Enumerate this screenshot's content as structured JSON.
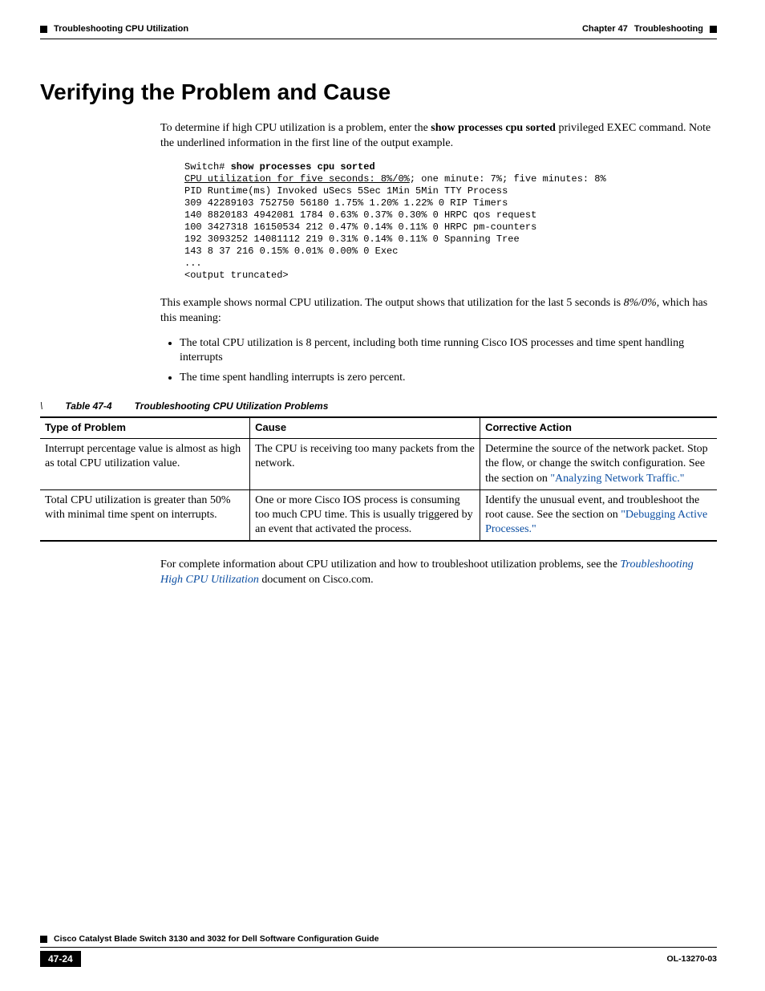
{
  "header": {
    "chapter_label": "Chapter 47",
    "chapter_title": "Troubleshooting",
    "section_breadcrumb": "Troubleshooting CPU Utilization"
  },
  "section": {
    "title": "Verifying the Problem and Cause",
    "intro_part1": "To determine if high CPU utilization is a problem, enter the ",
    "intro_cmd": "show processes cpu sorted",
    "intro_part2": " privileged EXEC command. Note the underlined information in the first line of the output example."
  },
  "code": {
    "prompt": "Switch# ",
    "cmd": "show processes cpu sorted",
    "underlined": "CPU utilization for five seconds: 8%/0%",
    "after_underlined": "; one minute: 7%; five minutes: 8%",
    "rest": "PID Runtime(ms) Invoked uSecs 5Sec 1Min 5Min TTY Process\n309 42289103 752750 56180 1.75% 1.20% 1.22% 0 RIP Timers\n140 8820183 4942081 1784 0.63% 0.37% 0.30% 0 HRPC qos request\n100 3427318 16150534 212 0.47% 0.14% 0.11% 0 HRPC pm-counters\n192 3093252 14081112 219 0.31% 0.14% 0.11% 0 Spanning Tree\n143 8 37 216 0.15% 0.01% 0.00% 0 Exec\n...\n<output truncated>"
  },
  "explanation": {
    "para_part1": "This example shows normal CPU utilization. The output shows that utilization for the last 5 seconds is ",
    "para_em": "8%/0%",
    "para_part2": ", which has this meaning:",
    "bullets": [
      "The total CPU utilization is 8 percent, including both time running Cisco IOS processes and time spent handling interrupts",
      "The time spent handling interrupts is zero percent."
    ]
  },
  "table": {
    "backslash": "\\",
    "number": "Table 47-4",
    "title": "Troubleshooting CPU Utilization Problems",
    "headers": [
      "Type of Problem",
      "Cause",
      "Corrective Action"
    ],
    "rows": [
      {
        "problem": "Interrupt percentage value is almost as high as total CPU utilization value.",
        "cause": "The CPU is receiving too many packets from the network.",
        "action_pre": "Determine the source of the network packet. Stop the flow, or change the switch configuration. See the section on ",
        "action_link": "\"Analyzing Network Traffic.\"",
        "action_post": ""
      },
      {
        "problem": "Total CPU utilization is greater than 50% with minimal time spent on interrupts.",
        "cause": "One or more Cisco IOS process is consuming too much CPU time. This is usually triggered by an event that activated the process.",
        "action_pre": "Identify the unusual event, and troubleshoot the root cause. See the section on ",
        "action_link": "\"Debugging Active Processes.\"",
        "action_post": ""
      }
    ]
  },
  "closing": {
    "part1": "For complete information about CPU utilization and how to troubleshoot utilization problems, see the ",
    "link": "Troubleshooting High CPU Utilization",
    "part2": " document on Cisco.com."
  },
  "footer": {
    "book_title": "Cisco Catalyst Blade Switch 3130 and 3032 for Dell Software Configuration Guide",
    "page_num": "47-24",
    "doc_id": "OL-13270-03"
  }
}
